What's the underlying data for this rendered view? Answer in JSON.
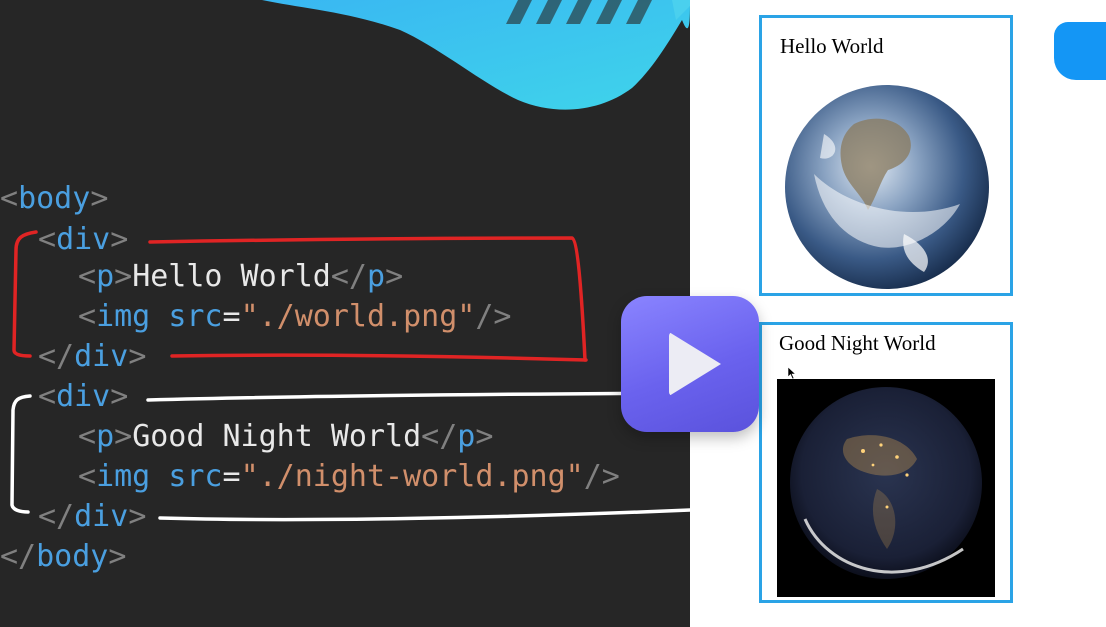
{
  "code": {
    "body_open": "body",
    "div_tag": "div",
    "p_tag": "p",
    "img_tag": "img",
    "src_attr": "src",
    "eq": "=",
    "body_close": "body",
    "block1": {
      "text": "Hello World",
      "src": "\"./world.png\""
    },
    "block2": {
      "text": "Good Night World",
      "src": "\"./night-world.png\""
    }
  },
  "preview": {
    "card1_text": "Hello World",
    "card2_text": "Good Night World"
  },
  "colors": {
    "code_bg": "#262626",
    "tag": "#4a9fe0",
    "string": "#d18f6b",
    "highlight_red": "#e02424",
    "highlight_white": "#ffffff",
    "card_border": "#2aa3e6",
    "play_button": "#6f68f2"
  },
  "icons": [
    "play-icon",
    "earth-day-image",
    "earth-night-image",
    "mouse-cursor-icon"
  ]
}
